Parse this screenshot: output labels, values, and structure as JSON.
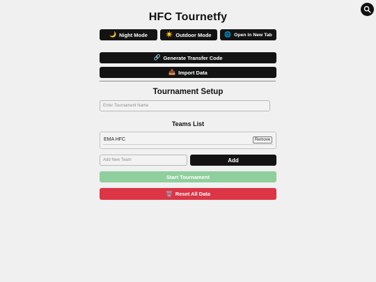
{
  "app": {
    "title": "HFC Tournetfy"
  },
  "toolbar": {
    "zoom_icon": "magnifier-icon",
    "night_mode": {
      "icon": "🌙",
      "label": "Night Mode"
    },
    "outdoor_mode": {
      "icon": "☀️",
      "label": "Outdoor Mode"
    },
    "open_new_tab": {
      "icon": "🌐",
      "label": "Open in New Tab"
    }
  },
  "transfer": {
    "generate": {
      "icon": "🔗",
      "label": "Generate Transfer Code"
    },
    "import": {
      "icon": "📥",
      "label": "Import Data"
    }
  },
  "setup": {
    "heading": "Tournament Setup",
    "tournament_name_placeholder": "Enter Tournament Name"
  },
  "teams": {
    "heading": "Teams List",
    "items": [
      {
        "name": "EMA HFC",
        "remove_label": "Remove"
      }
    ],
    "add_placeholder": "Add New Team",
    "add_label": "Add"
  },
  "actions": {
    "start": "Start Tournament",
    "reset": {
      "icon": "🗑️",
      "label": "Reset All Data"
    }
  },
  "colors": {
    "background": "#f0f0f0",
    "dark_button": "#131313",
    "start_button": "#8fcf9e",
    "reset_button": "#dc3545"
  }
}
